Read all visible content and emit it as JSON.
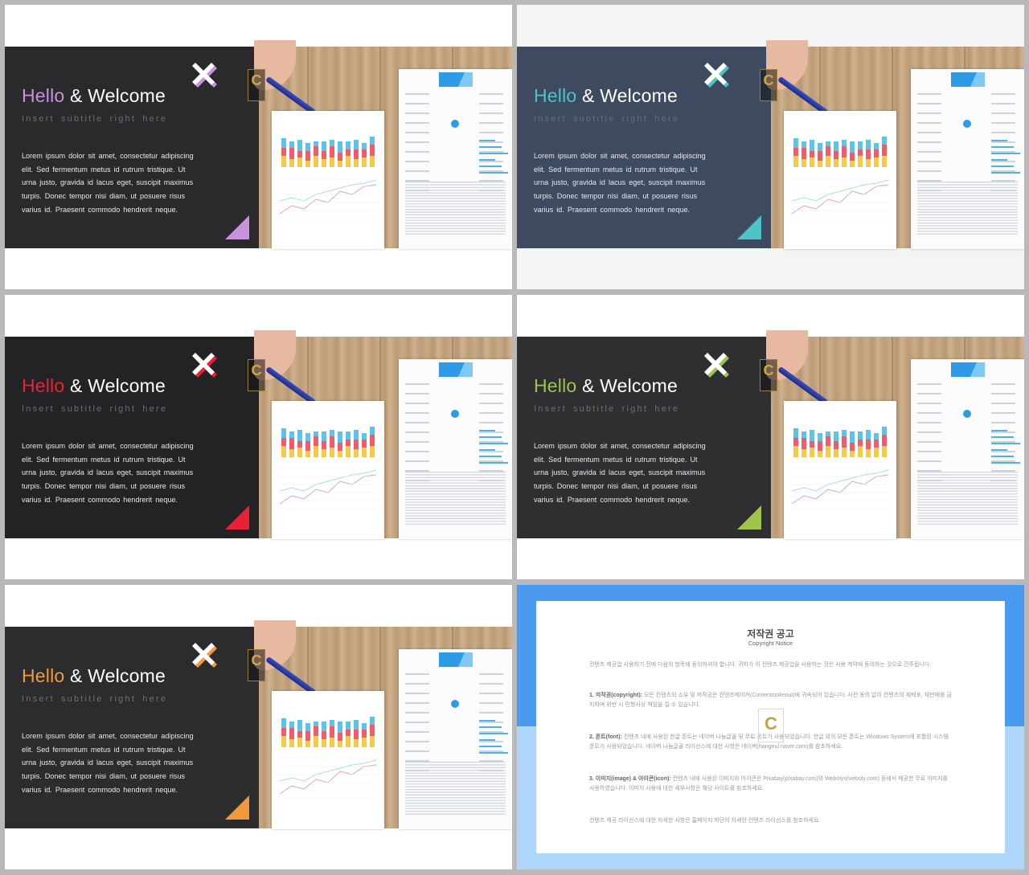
{
  "slides": [
    {
      "hello": "Hello",
      "rest": " & Welcome",
      "accent": "#c990dc",
      "bg": "#2a2a2d",
      "subtitle": "Insert  subtitle  right  here"
    },
    {
      "hello": "Hello",
      "rest": " & Welcome",
      "accent": "#4fc2c8",
      "bg": "#3d4a5f",
      "subtitle": "Insert  subtitle  right  here"
    },
    {
      "hello": "Hello",
      "rest": " & Welcome",
      "accent": "#ea2136",
      "bg": "#232326",
      "subtitle": "Insert  subtitle  right  here"
    },
    {
      "hello": "Hello",
      "rest": " & Welcome",
      "accent": "#9dc54b",
      "bg": "#2f2f32",
      "subtitle": "Insert  subtitle  right  here"
    },
    {
      "hello": "Hello",
      "rest": " & Welcome",
      "accent": "#f09a3c",
      "bg": "#2c2c2f",
      "subtitle": "Insert  subtitle  right  here"
    }
  ],
  "body_text": "Lorem  ipsum  dolor  sit  amet,  consectetur adipiscing  elit.  Sed  fermentum  metus  id  rutrum tristique.  Ut  urna  justo,  gravida  id  lacus  eget, suscipit  maximus  turpis.  Donec  tempor  nisi diam,  ut  posuere  risus  varius  id.  Praesent commodo  hendrerit  neque.",
  "copyright": {
    "title": "저작권 공고",
    "subtitle": "Copyright Notice",
    "intro": "컨텐츠 제공업 사용하기 전에 다음의 항목에 동의하셔야 합니다. 귀하가 이 컨텐츠 제공업을 사용하는 것은 사용 계약에 동의하는 것으로 간주됩니다.",
    "p1_label": "1. 저작권(copyright):",
    "p1": " 모든 컨텐츠의 소유 및 저작권은 컨텐츠메이커(Contentstokeout)에 귀속되어 있습니다. 사전 동의 없이 컨텐츠의 재배포, 재판매를 금지하며 위반 시 민형사상 책임을 질 수 있습니다.",
    "p2_label": "2. 폰트(font):",
    "p2": " 컨텐츠 내에 사용된 한글 폰트는 네이버 나눔글꼴 및 무료 폰트가 사용되었습니다. 한글 외의 모든 폰트는 Windows System에 포함된 시스템 폰트가 사용되었습니다. 네이버 나눔글꼴 라이선스에 대한 사항은 네이버(hangeul.naver.com)를 참조하세요.",
    "p3_label": "3. 이미지(image) & 아이콘(icon):",
    "p3": " 컨텐츠 내에 사용된 이미지와 아이콘은 Pixabay(pixabay.com)와 Webolys(weboly.com) 등에서 제공한 무료 이미지를 사용하였습니다. 이미지 사용에 대한 세부사항은 해당 사이트를 참조하세요.",
    "outro": "컨텐츠 제공 라이선스에 대한 자세한 사항은 홈페이지 하단의 자세한 컨텐츠 라이선스를 참조하세요.",
    "logo": "C"
  }
}
